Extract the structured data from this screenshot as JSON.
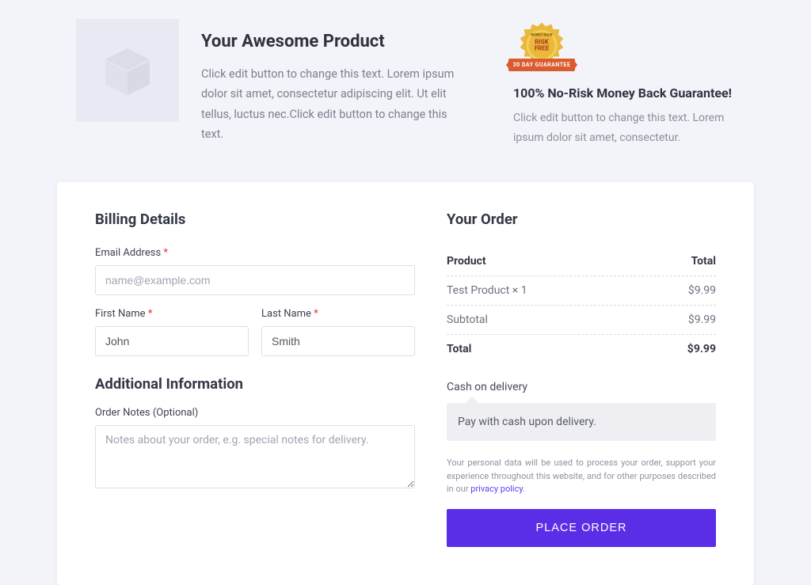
{
  "hero": {
    "title": "Your Awesome Product",
    "description": "Click edit button to change this text. Lorem ipsum dolor sit amet, consectetur adipiscing elit. Ut elit tellus, luctus nec.Click edit button to change this text."
  },
  "guarantee": {
    "badge_top": "MONEY BACK",
    "badge_mid": "RISK\nFREE",
    "badge_ribbon": "30 DAY GUARANTEE",
    "title": "100% No-Risk Money Back Guarantee!",
    "text": "Click edit button to change this text. Lorem ipsum dolor sit amet, consectetur."
  },
  "billing": {
    "heading": "Billing Details",
    "email_label": "Email Address",
    "email_placeholder": "name@example.com",
    "first_name_label": "First Name",
    "first_name_value": "John",
    "last_name_label": "Last Name",
    "last_name_value": "Smith",
    "additional_heading": "Additional Information",
    "notes_label": "Order Notes (Optional)",
    "notes_placeholder": "Notes about your order, e.g. special notes for delivery."
  },
  "order": {
    "heading": "Your Order",
    "col_product": "Product",
    "col_total": "Total",
    "line_item": "Test Product  × 1",
    "line_total": "$9.99",
    "subtotal_label": "Subtotal",
    "subtotal_value": "$9.99",
    "total_label": "Total",
    "total_value": "$9.99",
    "payment_method": "Cash on delivery",
    "payment_desc": "Pay with cash upon delivery.",
    "privacy_pre": "Your personal data will be used to process your order, support your experience throughout this website, and for other purposes described in our ",
    "privacy_link": "privacy policy",
    "privacy_post": ".",
    "button": "PLACE ORDER"
  }
}
